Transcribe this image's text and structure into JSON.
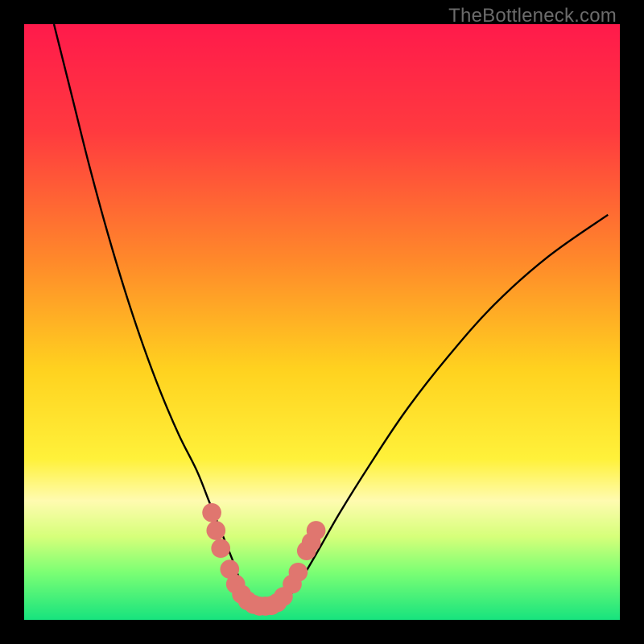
{
  "watermark": "TheBottleneck.com",
  "chart_data": {
    "type": "line",
    "title": "",
    "xlabel": "",
    "ylabel": "",
    "xlim": [
      0,
      100
    ],
    "ylim": [
      0,
      100
    ],
    "grid": false,
    "legend": false,
    "gradient_stops": [
      {
        "pct": 0,
        "color": "#ff1a4b"
      },
      {
        "pct": 18,
        "color": "#ff3a3f"
      },
      {
        "pct": 40,
        "color": "#ff8a2a"
      },
      {
        "pct": 58,
        "color": "#ffd21f"
      },
      {
        "pct": 73,
        "color": "#fff13a"
      },
      {
        "pct": 80,
        "color": "#fffbb0"
      },
      {
        "pct": 86,
        "color": "#d6ff7a"
      },
      {
        "pct": 92,
        "color": "#7cff74"
      },
      {
        "pct": 100,
        "color": "#17e37e"
      }
    ],
    "series": [
      {
        "name": "bottleneck-curve",
        "color": "#000000",
        "x": [
          5,
          8,
          11,
          14,
          17,
          20,
          23,
          26,
          29,
          31,
          33,
          35,
          36.5,
          38,
          40,
          42,
          44,
          46,
          49,
          53,
          58,
          64,
          71,
          79,
          88,
          98
        ],
        "y": [
          100,
          88,
          76,
          65,
          55,
          46,
          38,
          31,
          25,
          20,
          15,
          10,
          6,
          3.5,
          2.3,
          2.3,
          3.5,
          6,
          11,
          18,
          26,
          35,
          44,
          53,
          61,
          68
        ]
      }
    ],
    "markers": {
      "color": "#e0766f",
      "radius": 1.6,
      "points": [
        {
          "x": 31.5,
          "y": 18
        },
        {
          "x": 32.2,
          "y": 15
        },
        {
          "x": 33.0,
          "y": 12
        },
        {
          "x": 34.5,
          "y": 8.5
        },
        {
          "x": 35.5,
          "y": 6.0
        },
        {
          "x": 36.5,
          "y": 4.3
        },
        {
          "x": 37.5,
          "y": 3.2
        },
        {
          "x": 38.5,
          "y": 2.6
        },
        {
          "x": 39.5,
          "y": 2.3
        },
        {
          "x": 40.5,
          "y": 2.3
        },
        {
          "x": 41.5,
          "y": 2.4
        },
        {
          "x": 42.5,
          "y": 2.9
        },
        {
          "x": 43.5,
          "y": 3.9
        },
        {
          "x": 45.0,
          "y": 6.0
        },
        {
          "x": 46.0,
          "y": 8.0
        },
        {
          "x": 47.4,
          "y": 11.6
        },
        {
          "x": 48.2,
          "y": 13.0
        },
        {
          "x": 49.0,
          "y": 15.0
        }
      ]
    }
  }
}
